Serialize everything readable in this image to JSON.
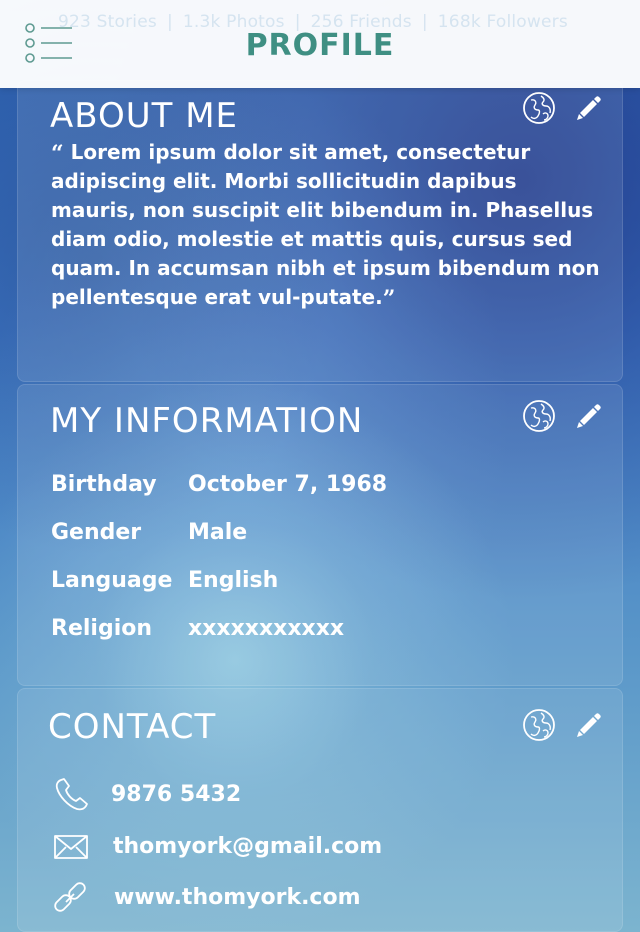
{
  "header": {
    "title": "PROFILE",
    "menu_icon": "menu-list-icon",
    "stats": {
      "stories": "923 Stories",
      "photos": "1.3k Photos",
      "friends": "256 Friends",
      "followers": "168k Followers",
      "separator": "|"
    }
  },
  "about": {
    "title": "ABOUT ME",
    "text": "Lorem ipsum dolor sit amet, consectetur adipiscing elit. Morbi sollicitudin dapibus mauris, non suscipit elit bibendum in. Phasellus diam odio, molestie et mattis quis, cursus sed quam. In accumsan nibh et ipsum bibendum non pellentesque erat vul-putate.",
    "open_quote": "“",
    "close_quote": "”",
    "actions": {
      "globe_icon": "globe-icon",
      "edit_icon": "pencil-icon"
    }
  },
  "information": {
    "title": "MY INFORMATION",
    "rows": [
      {
        "label": "Birthday",
        "value": "October 7, 1968"
      },
      {
        "label": "Gender",
        "value": "Male"
      },
      {
        "label": "Language",
        "value": "English"
      },
      {
        "label": "Religion",
        "value": "xxxxxxxxxxx"
      }
    ],
    "actions": {
      "globe_icon": "globe-icon",
      "edit_icon": "pencil-icon"
    }
  },
  "contact": {
    "title": "CONTACT",
    "rows": [
      {
        "icon": "phone-icon",
        "text": "9876 5432"
      },
      {
        "icon": "envelope-icon",
        "text": "thomyork@gmail.com"
      },
      {
        "icon": "link-icon",
        "text": "www.thomyork.com"
      }
    ],
    "actions": {
      "globe_icon": "globe-icon",
      "edit_icon": "pencil-icon"
    }
  },
  "colors": {
    "title_teal": "#3f8f83",
    "header_bg": "#ffffff",
    "text_white": "#ffffff"
  }
}
